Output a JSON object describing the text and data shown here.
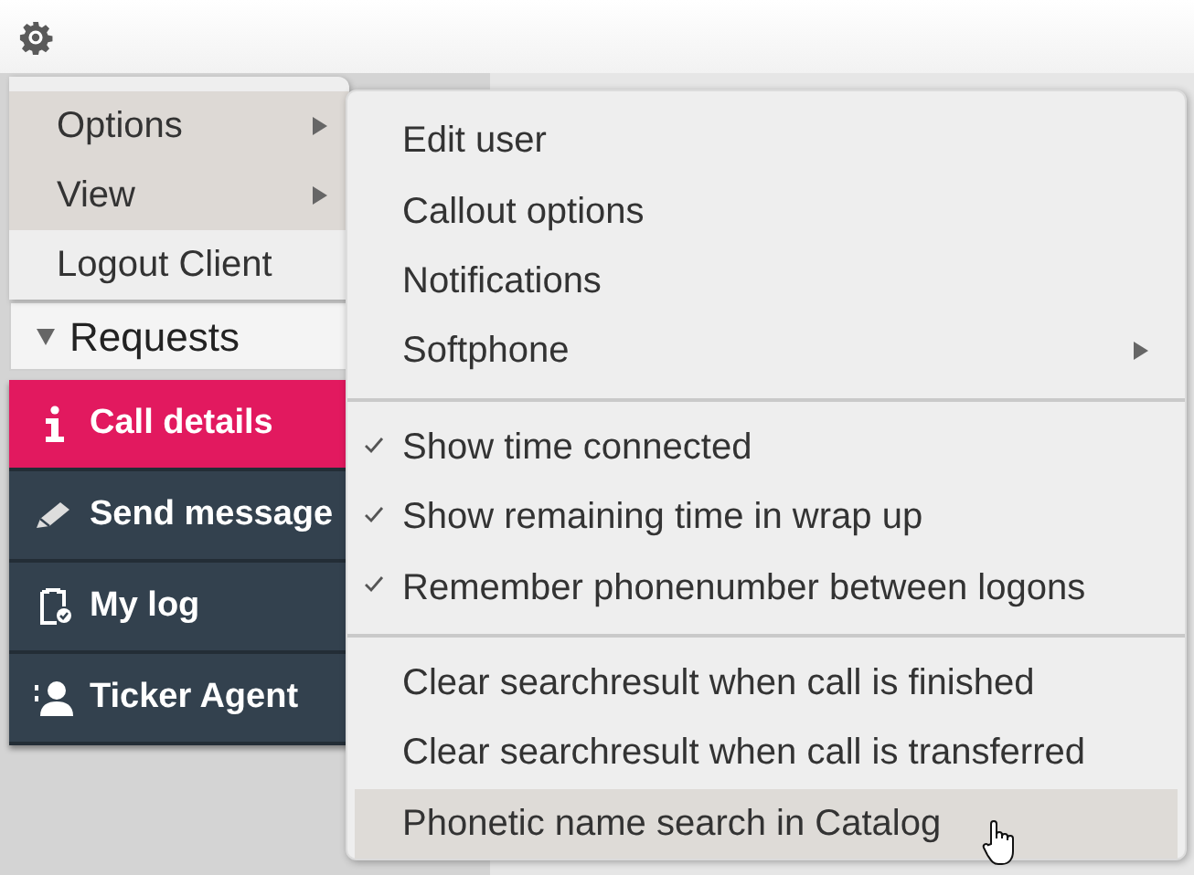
{
  "sidebar": {
    "requests_header": "Requests",
    "items": [
      {
        "label": "Call details",
        "selected": true
      },
      {
        "label": "Send message",
        "selected": false
      },
      {
        "label": "My log",
        "selected": false
      },
      {
        "label": "Ticker Agent",
        "selected": false
      }
    ]
  },
  "menu": {
    "items": [
      {
        "label": "Options",
        "has_submenu": true,
        "selected": true
      },
      {
        "label": "View",
        "has_submenu": true,
        "selected": true
      },
      {
        "label": "Logout Client",
        "has_submenu": false,
        "selected": false
      }
    ]
  },
  "submenu": {
    "groups": [
      [
        {
          "label": "Edit user",
          "kind": "item",
          "has_submenu": false,
          "selected": false
        },
        {
          "label": "Callout options",
          "kind": "item",
          "has_submenu": false,
          "selected": false
        },
        {
          "label": "Notifications",
          "kind": "item",
          "has_submenu": false,
          "selected": false
        },
        {
          "label": "Softphone",
          "kind": "item",
          "has_submenu": true,
          "selected": false
        }
      ],
      [
        {
          "label": "Show time connected",
          "kind": "check",
          "checked": true,
          "selected": false
        },
        {
          "label": "Show remaining time in wrap up",
          "kind": "check",
          "checked": true,
          "selected": false
        },
        {
          "label": "Remember phonenumber between logons",
          "kind": "check",
          "checked": true,
          "selected": false
        }
      ],
      [
        {
          "label": "Clear searchresult when call is finished",
          "kind": "item",
          "has_submenu": false,
          "selected": false
        },
        {
          "label": "Clear searchresult when call is transferred",
          "kind": "item",
          "has_submenu": false,
          "selected": false
        },
        {
          "label": "Phonetic name search in Catalog",
          "kind": "item",
          "has_submenu": false,
          "selected": true
        }
      ]
    ]
  }
}
